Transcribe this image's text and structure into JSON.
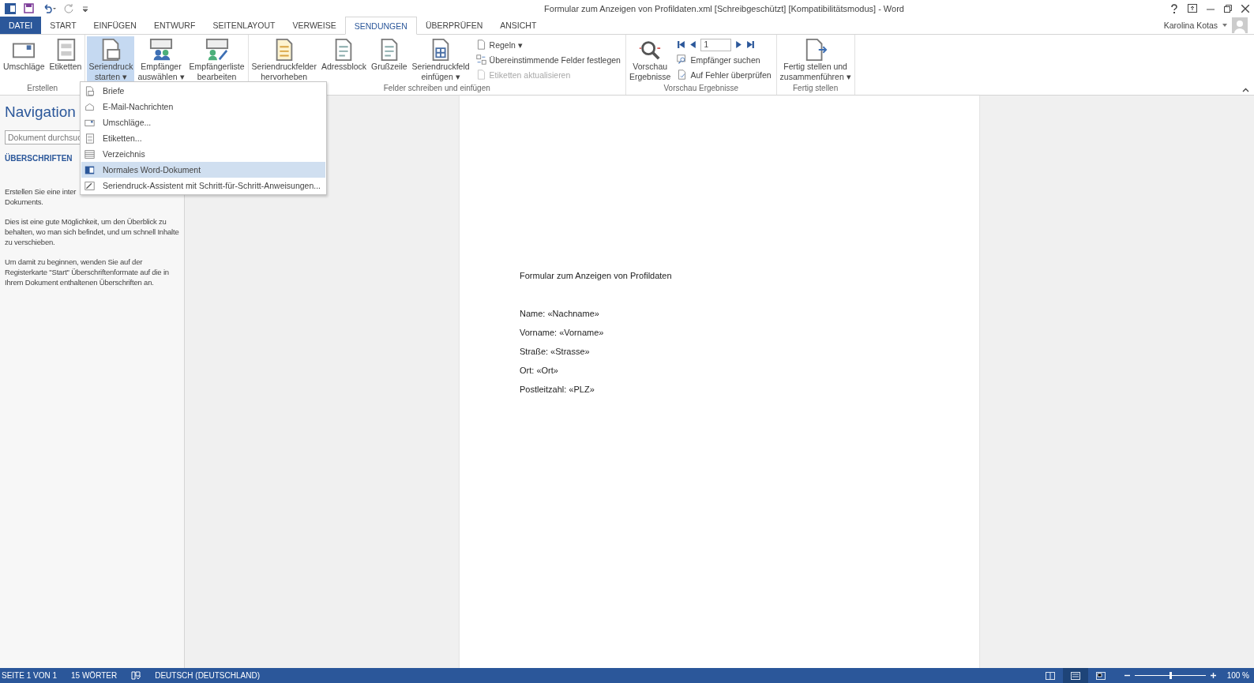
{
  "window": {
    "title": "Formular zum Anzeigen von Profildaten.xml [Schreibgeschützt] [Kompatibilitätsmodus] - Word",
    "user": "Karolina Kotas"
  },
  "file_tab": "DATEI",
  "tabs": [
    {
      "label": "START",
      "selected": false
    },
    {
      "label": "EINFÜGEN",
      "selected": false
    },
    {
      "label": "ENTWURF",
      "selected": false
    },
    {
      "label": "SEITENLAYOUT",
      "selected": false
    },
    {
      "label": "VERWEISE",
      "selected": false
    },
    {
      "label": "SENDUNGEN",
      "selected": true
    },
    {
      "label": "ÜBERPRÜFEN",
      "selected": false
    },
    {
      "label": "ANSICHT",
      "selected": false
    }
  ],
  "ribbon": [
    {
      "label": "Erstellen",
      "items": [
        {
          "kind": "large",
          "lines": [
            "Umschläge"
          ],
          "pressed": false
        },
        {
          "kind": "large",
          "lines": [
            "Etiketten"
          ],
          "pressed": false
        }
      ]
    },
    {
      "items": [
        {
          "kind": "large",
          "lines": [
            "Seriendruck",
            "starten ▾"
          ],
          "pressed": true
        },
        {
          "kind": "large",
          "lines": [
            "Empfänger",
            "auswählen ▾"
          ],
          "pressed": false
        },
        {
          "kind": "large",
          "lines": [
            "Empfängerliste",
            "bearbeiten"
          ],
          "pressed": false
        }
      ]
    },
    {
      "label": "Felder schreiben und einfügen",
      "items": [
        {
          "kind": "large",
          "lines": [
            "Seriendruckfelder",
            "hervorheben"
          ],
          "pressed": false
        },
        {
          "kind": "large",
          "lines": [
            "Adressblock"
          ],
          "pressed": false
        },
        {
          "kind": "large",
          "lines": [
            "Grußzeile"
          ],
          "pressed": false
        },
        {
          "kind": "large",
          "lines": [
            "Seriendruckfeld",
            "einfügen ▾"
          ],
          "pressed": false
        },
        {
          "kind": "small-stack",
          "rows": [
            {
              "label": "Regeln ▾",
              "disabled": false
            },
            {
              "label": "Übereinstimmende Felder festlegen",
              "disabled": false
            },
            {
              "label": "Etiketten aktualisieren",
              "disabled": true
            }
          ]
        }
      ]
    },
    {
      "label": "Vorschau Ergebnisse",
      "items": [
        {
          "kind": "large",
          "lines": [
            "Vorschau",
            "Ergebnisse"
          ],
          "pressed": false
        },
        {
          "kind": "record-nav",
          "record": "1",
          "rows": [
            {
              "label": "Empfänger suchen",
              "disabled": false
            },
            {
              "label": "Auf Fehler überprüfen",
              "disabled": false
            }
          ]
        }
      ]
    },
    {
      "label": "Fertig stellen",
      "items": [
        {
          "kind": "large",
          "lines": [
            "Fertig stellen und",
            "zusammenführen ▾"
          ],
          "pressed": false
        }
      ]
    }
  ],
  "menu": [
    {
      "label": "Briefe",
      "selected": false
    },
    {
      "label": "E-Mail-Nachrichten",
      "selected": false
    },
    {
      "label": "Umschläge...",
      "selected": false
    },
    {
      "label": "Etiketten...",
      "selected": false
    },
    {
      "label": "Verzeichnis",
      "selected": false
    },
    {
      "label": "Normales Word-Dokument",
      "selected": true
    },
    {
      "label": "Seriendruck-Assistent mit Schritt-für-Schritt-Anweisungen...",
      "selected": false
    }
  ],
  "navigation": {
    "title": "Navigation",
    "search": {
      "placeholder": "Dokument durchsuc"
    },
    "tab": "ÜBERSCHRIFTEN",
    "paragraphs": [
      [
        "Erstellen Sie eine inter",
        "Dokuments."
      ],
      [
        "Dies ist eine gute Möglichkeit, um den Überblick zu behalten, wo man sich befindet, und um schnell Inhalte zu verschieben."
      ],
      [
        "Um damit zu beginnen, wenden Sie auf der Registerkarte \"Start\" Überschriftenformate auf die in Ihrem Dokument enthaltenen Überschriften an."
      ]
    ]
  },
  "document": {
    "heading": "Formular zum Anzeigen von Profildaten",
    "fields": [
      "Name: «Nachname»",
      "Vorname: «Vorname»",
      "Straße: «Strasse»",
      "Ort: «Ort»",
      "Postleitzahl: «PLZ»"
    ]
  },
  "status_bar": {
    "items": [
      "SEITE 1 VON 1",
      "15 WÖRTER",
      "DEUTSCH (DEUTSCHLAND)"
    ],
    "views": [
      {
        "selected": false
      },
      {
        "selected": true
      },
      {
        "selected": false
      }
    ],
    "zoom": {
      "level": 0.5,
      "reading": "100 %"
    }
  }
}
